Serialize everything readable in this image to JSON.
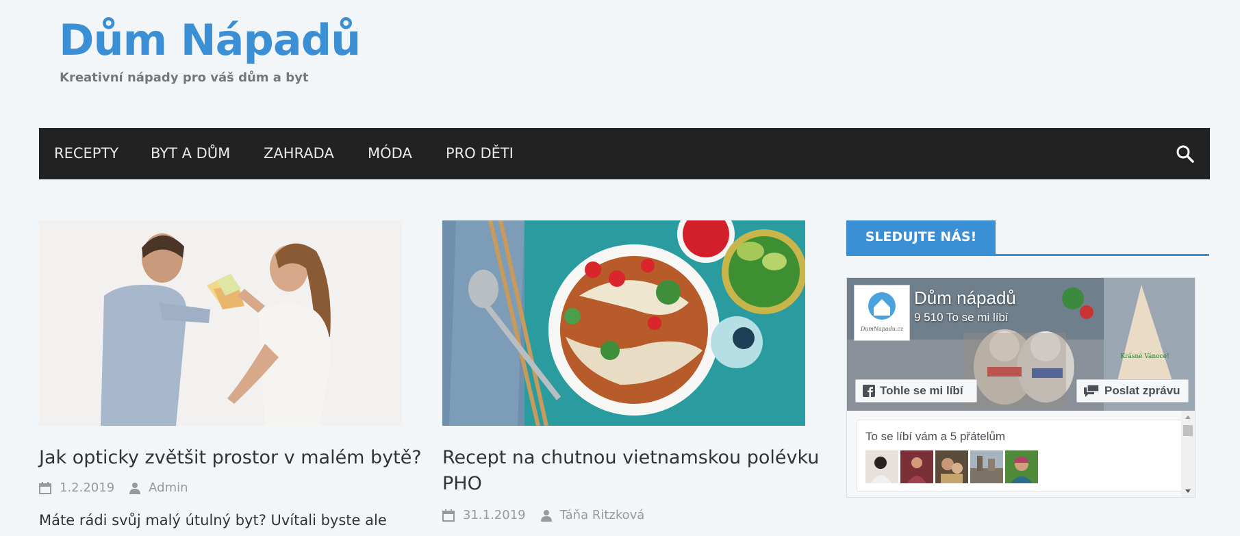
{
  "site": {
    "title": "Dům Nápadů",
    "tagline": "Kreativní nápady pro váš dům a byt"
  },
  "nav": {
    "items": [
      "RECEPTY",
      "BYT A DŮM",
      "ZAHRADA",
      "MÓDA",
      "PRO DĚTI"
    ],
    "search_icon": "search-icon"
  },
  "posts": [
    {
      "title": "Jak opticky zvětšit prostor v malém bytě?",
      "date": "1.2.2019",
      "author": "Admin",
      "excerpt": "Máte rádi svůj malý útulný byt? Uvítali byste ale"
    },
    {
      "title_line1": "Recept na chutnou vietnamskou polévku",
      "title_line2": "PHO",
      "date": "31.1.2019",
      "author": "Táňa Ritzková"
    }
  ],
  "sidebar": {
    "widget_title": "SLEDUJTE NÁS!",
    "fb": {
      "page_name": "Dům nápadů",
      "likes": "9 510 To se mi líbí",
      "like_button": "Tohle se mi líbí",
      "message_button": "Poslat zprávu",
      "friends_text": "To se líbí vám a 5 přátelům",
      "logo_text": "DumNapadu.cz",
      "cover_text": "Krásné Vánoce!"
    }
  },
  "colors": {
    "accent": "#3b8fd4",
    "navbar": "#222222",
    "background": "#f3f6f9"
  }
}
